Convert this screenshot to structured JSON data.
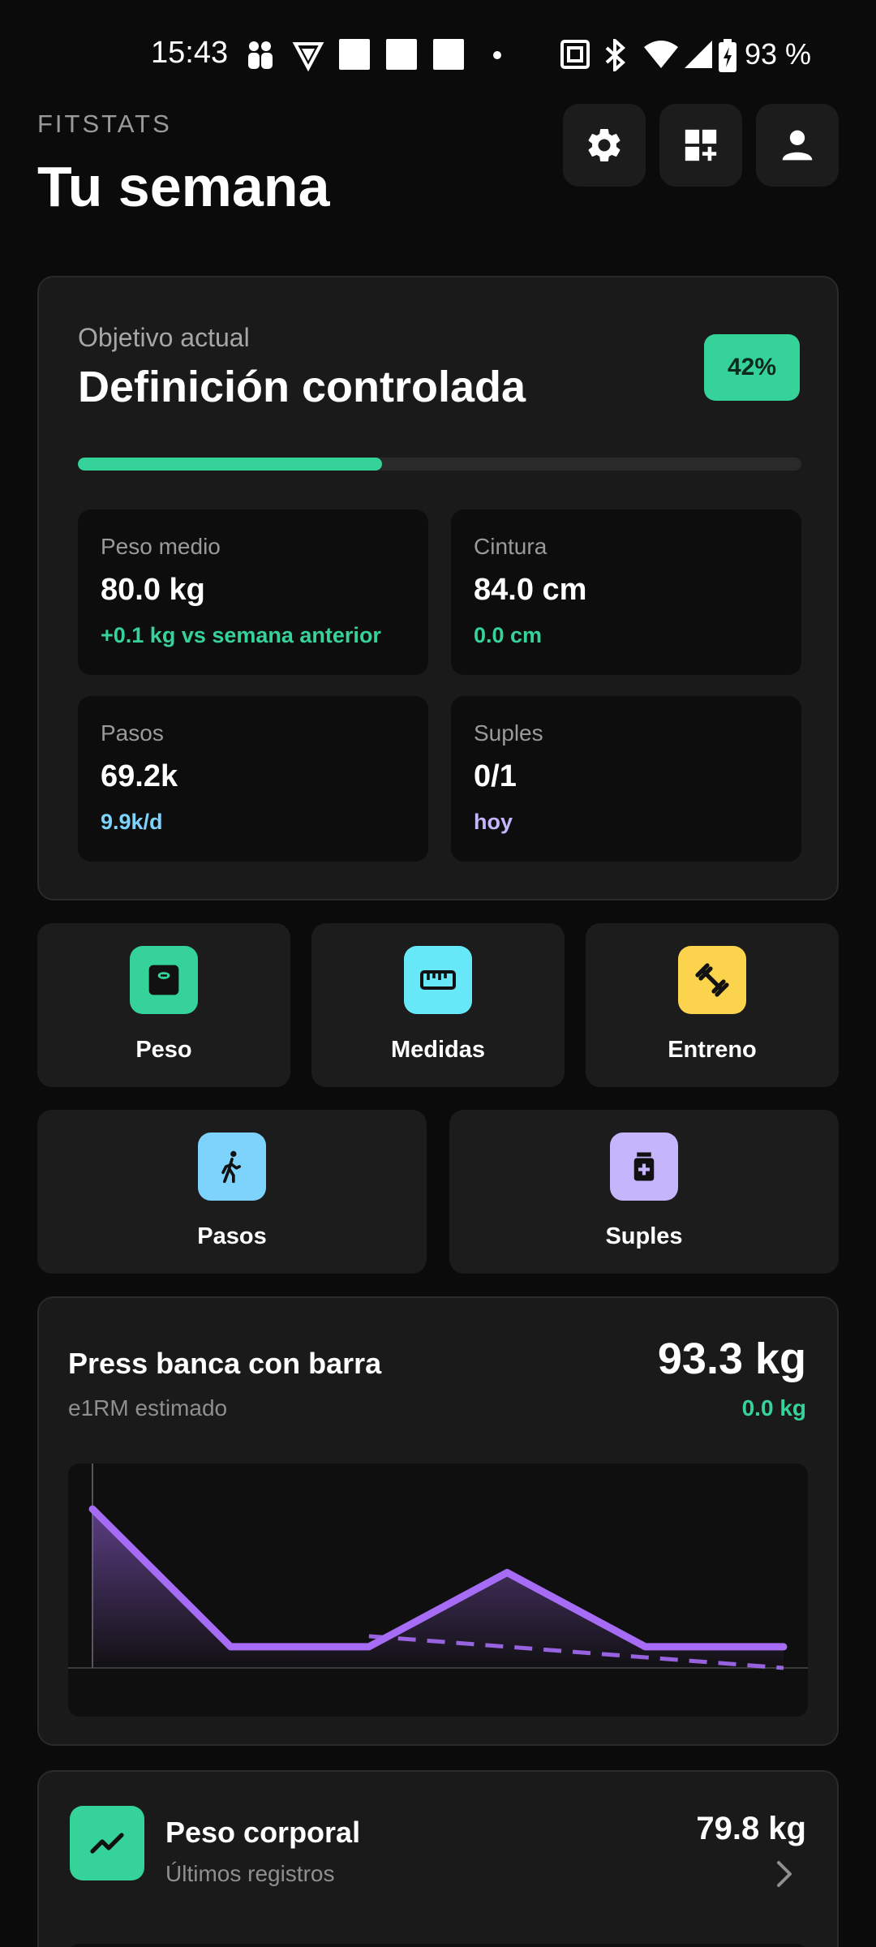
{
  "status_bar": {
    "time": "15:43",
    "battery": "93 %",
    "icons": [
      "notification-icon",
      "vpn-icon",
      "nfc-icon",
      "bluetooth-icon",
      "wifi-icon",
      "signal-icon",
      "battery-charging-icon"
    ]
  },
  "header": {
    "brand": "FITSTATS",
    "title": "Tu semana",
    "buttons": [
      "gear-icon",
      "add-widget-icon",
      "person-icon"
    ]
  },
  "goal": {
    "label": "Objetivo actual",
    "title": "Definición controlada",
    "badge": "42%",
    "progress": 0.42,
    "stats": [
      {
        "label": "Peso medio",
        "value": "80.0 kg",
        "sub": "+0.1 kg vs semana anterior",
        "sub_color": "#35d399"
      },
      {
        "label": "Cintura",
        "value": "84.0 cm",
        "sub": "0.0 cm",
        "sub_color": "#35d399"
      },
      {
        "label": "Pasos",
        "value": "69.2k",
        "sub": "9.9k/d",
        "sub_color": "#7dd3fc"
      },
      {
        "label": "Suples",
        "value": "0/1",
        "sub": "hoy",
        "sub_color": "#c4b5fd"
      }
    ]
  },
  "tiles": [
    {
      "label": "Peso",
      "icon": "scale-icon",
      "color": "#35d399"
    },
    {
      "label": "Medidas",
      "icon": "ruler-icon",
      "color": "#67e8f9"
    },
    {
      "label": "Entreno",
      "icon": "dumbbell-icon",
      "color": "#fcd34d"
    },
    {
      "label": "Pasos",
      "icon": "walking-icon",
      "color": "#7dd3fc"
    },
    {
      "label": "Suples",
      "icon": "supplement-icon",
      "color": "#c4b5fd"
    }
  ],
  "exercise": {
    "title": "Press banca con barra",
    "subtitle": "e1RM estimado",
    "value": "93.3 kg",
    "delta": "0.0 kg",
    "line_color": "#a66cf5"
  },
  "chart_data": {
    "type": "line",
    "title": "Press banca con barra",
    "xlabel": "",
    "ylabel": "",
    "series": [
      {
        "values": [
          94.6,
          93.3,
          93.3,
          94.0,
          93.3,
          93.3
        ]
      }
    ],
    "trend": {
      "style": "dashed",
      "values": [
        null,
        null,
        93.4,
        93.3,
        93.2,
        93.1
      ]
    },
    "ylim": [
      93.1,
      94.8
    ],
    "grid": false
  },
  "weight": {
    "title": "Peso corporal",
    "subtitle": "Últimos registros",
    "value": "79.8 kg",
    "icon": "trending-icon"
  }
}
